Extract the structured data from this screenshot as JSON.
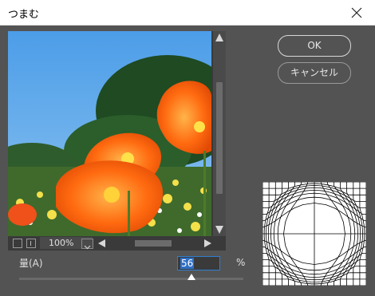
{
  "window": {
    "title": "つまむ"
  },
  "buttons": {
    "ok": "OK",
    "cancel": "キャンセル"
  },
  "preview": {
    "zoom": "100%"
  },
  "amount": {
    "label": "量(A)",
    "value": "56",
    "unit": "%",
    "slider_percent": 56
  },
  "icons": [
    "close-icon",
    "scroll-up-icon",
    "scroll-down-icon",
    "zoom-out-icon",
    "zoom-in-icon",
    "chevron-down-icon",
    "scroll-left-icon",
    "scroll-right-icon",
    "slider-thumb-icon"
  ]
}
